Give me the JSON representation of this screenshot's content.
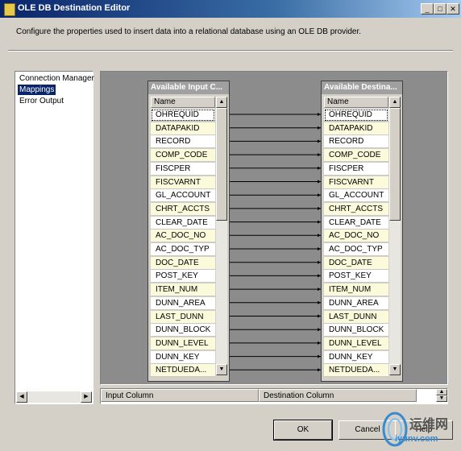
{
  "window": {
    "title": "OLE DB Destination Editor",
    "minimize": "_",
    "maximize": "□",
    "close": "✕"
  },
  "description": "Configure the properties used to insert data into a relational database using an OLE DB provider.",
  "nav": {
    "items": [
      {
        "label": "Connection Manager",
        "selected": false
      },
      {
        "label": "Mappings",
        "selected": true
      },
      {
        "label": "Error Output",
        "selected": false
      }
    ]
  },
  "input_table": {
    "title": "Available Input C...",
    "header": "Name",
    "rows": [
      "OHREQUID",
      "DATAPAKID",
      "RECORD",
      "COMP_CODE",
      "FISCPER",
      "FISCVARNT",
      "GL_ACCOUNT",
      "CHRT_ACCTS",
      "CLEAR_DATE",
      "AC_DOC_NO",
      "AC_DOC_TYP",
      "DOC_DATE",
      "POST_KEY",
      "ITEM_NUM",
      "DUNN_AREA",
      "LAST_DUNN",
      "DUNN_BLOCK",
      "DUNN_LEVEL",
      "DUNN_KEY",
      "NETDUEDA..."
    ]
  },
  "dest_table": {
    "title": "Available Destina...",
    "header": "Name",
    "rows": [
      "OHREQUID",
      "DATAPAKID",
      "RECORD",
      "COMP_CODE",
      "FISCPER",
      "FISCVARNT",
      "GL_ACCOUNT",
      "CHRT_ACCTS",
      "CLEAR_DATE",
      "AC_DOC_NO",
      "AC_DOC_TYP",
      "DOC_DATE",
      "POST_KEY",
      "ITEM_NUM",
      "DUNN_AREA",
      "LAST_DUNN",
      "DUNN_BLOCK",
      "DUNN_LEVEL",
      "DUNN_KEY",
      "NETDUEDA..."
    ]
  },
  "grid": {
    "col1": "Input Column",
    "col2": "Destination Column"
  },
  "buttons": {
    "ok": "OK",
    "cancel": "Cancel",
    "help": "Help"
  },
  "watermark": {
    "line1": "运维网",
    "line2": "iyunv.com"
  },
  "colors": {
    "titlebar": "#0a246a",
    "selection": "#0a246a",
    "row_alt": "#fbfbdc",
    "mapping_bg": "#8c8c8c"
  }
}
